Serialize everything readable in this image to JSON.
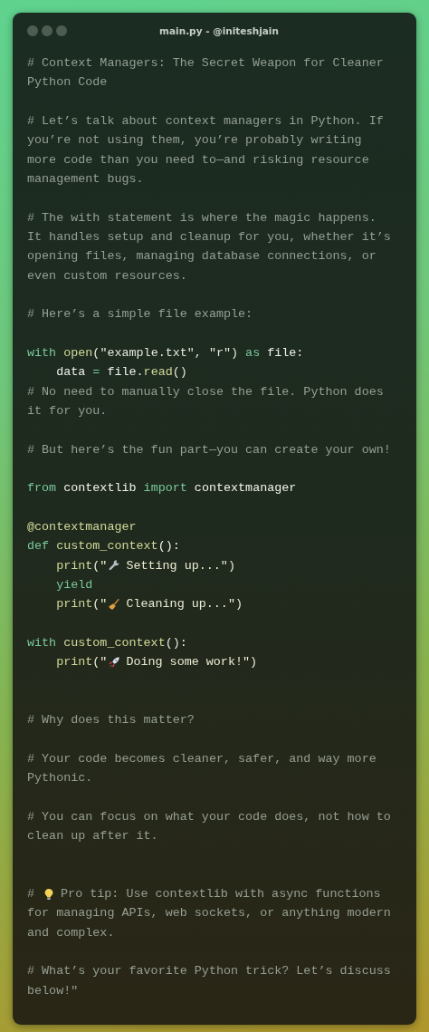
{
  "window": {
    "title": "main.py - @initeshjain"
  },
  "lines": [
    {
      "kind": "code",
      "tokens": [
        {
          "kind": "comment",
          "text": "# Context Managers: The Secret Weapon for Cleaner"
        }
      ]
    },
    {
      "kind": "code",
      "tokens": [
        {
          "kind": "comment",
          "text": "Python Code"
        }
      ]
    },
    {
      "kind": "blank"
    },
    {
      "kind": "code",
      "tokens": [
        {
          "kind": "comment",
          "text": "# Let’s talk about context managers in Python. If"
        }
      ]
    },
    {
      "kind": "code",
      "tokens": [
        {
          "kind": "comment",
          "text": "you’re not using them, you’re probably writing"
        }
      ]
    },
    {
      "kind": "code",
      "tokens": [
        {
          "kind": "comment",
          "text": "more code than you need to—and risking resource"
        }
      ]
    },
    {
      "kind": "code",
      "tokens": [
        {
          "kind": "comment",
          "text": "management bugs."
        }
      ]
    },
    {
      "kind": "blank"
    },
    {
      "kind": "code",
      "tokens": [
        {
          "kind": "comment",
          "text": "# The with statement is where the magic happens."
        }
      ]
    },
    {
      "kind": "code",
      "tokens": [
        {
          "kind": "comment",
          "text": "It handles setup and cleanup for you, whether it’s"
        }
      ]
    },
    {
      "kind": "code",
      "tokens": [
        {
          "kind": "comment",
          "text": "opening files, managing database connections, or"
        }
      ]
    },
    {
      "kind": "code",
      "tokens": [
        {
          "kind": "comment",
          "text": "even custom resources."
        }
      ]
    },
    {
      "kind": "blank"
    },
    {
      "kind": "code",
      "tokens": [
        {
          "kind": "comment",
          "text": "# Here’s a simple file example:"
        }
      ]
    },
    {
      "kind": "blank"
    },
    {
      "kind": "code",
      "tokens": [
        {
          "kind": "keyword",
          "text": "with "
        },
        {
          "kind": "function",
          "text": "open"
        },
        {
          "kind": "plain",
          "text": "(\"example.txt\", \"r\") "
        },
        {
          "kind": "keyword",
          "text": "as "
        },
        {
          "kind": "name",
          "text": "file"
        },
        {
          "kind": "plain",
          "text": ":"
        }
      ]
    },
    {
      "kind": "code",
      "tokens": [
        {
          "kind": "name",
          "text": "    data "
        },
        {
          "kind": "keyword",
          "text": "= "
        },
        {
          "kind": "name",
          "text": "file"
        },
        {
          "kind": "plain",
          "text": "."
        },
        {
          "kind": "function",
          "text": "read"
        },
        {
          "kind": "plain",
          "text": "()"
        }
      ]
    },
    {
      "kind": "code",
      "tokens": [
        {
          "kind": "comment",
          "text": "# No need to manually close the file. Python does"
        }
      ]
    },
    {
      "kind": "code",
      "tokens": [
        {
          "kind": "comment",
          "text": "it for you."
        }
      ]
    },
    {
      "kind": "blank"
    },
    {
      "kind": "code",
      "tokens": [
        {
          "kind": "comment",
          "text": "# But here’s the fun part—you can create your own!"
        }
      ]
    },
    {
      "kind": "blank"
    },
    {
      "kind": "code",
      "tokens": [
        {
          "kind": "keyword",
          "text": "from "
        },
        {
          "kind": "name",
          "text": "contextlib "
        },
        {
          "kind": "keyword",
          "text": "import "
        },
        {
          "kind": "name",
          "text": "contextmanager"
        }
      ]
    },
    {
      "kind": "blank"
    },
    {
      "kind": "code",
      "tokens": [
        {
          "kind": "function",
          "text": "@contextmanager"
        }
      ]
    },
    {
      "kind": "code",
      "tokens": [
        {
          "kind": "keyword",
          "text": "def "
        },
        {
          "kind": "function",
          "text": "custom_context"
        },
        {
          "kind": "name",
          "text": "():"
        }
      ]
    },
    {
      "kind": "code",
      "tokens": [
        {
          "kind": "function",
          "text": "    print"
        },
        {
          "kind": "string",
          "text": "(\""
        },
        {
          "kind": "wrench"
        },
        {
          "kind": "string",
          "text": "Setting up...\")"
        }
      ]
    },
    {
      "kind": "code",
      "tokens": [
        {
          "kind": "keyword",
          "text": "    yield"
        }
      ]
    },
    {
      "kind": "code",
      "tokens": [
        {
          "kind": "function",
          "text": "    print"
        },
        {
          "kind": "string",
          "text": "(\""
        },
        {
          "kind": "broom"
        },
        {
          "kind": "string",
          "text": "Cleaning up...\")"
        }
      ]
    },
    {
      "kind": "blank"
    },
    {
      "kind": "code",
      "tokens": [
        {
          "kind": "keyword",
          "text": "with "
        },
        {
          "kind": "function",
          "text": "custom_context"
        },
        {
          "kind": "plain",
          "text": "():"
        }
      ]
    },
    {
      "kind": "code",
      "tokens": [
        {
          "kind": "function",
          "text": "    print"
        },
        {
          "kind": "string",
          "text": "(\""
        },
        {
          "kind": "rocket"
        },
        {
          "kind": "string",
          "text": "Doing some work!\")"
        }
      ]
    },
    {
      "kind": "blank"
    },
    {
      "kind": "blank"
    },
    {
      "kind": "code",
      "tokens": [
        {
          "kind": "comment",
          "text": "# Why does this matter?"
        }
      ]
    },
    {
      "kind": "blank"
    },
    {
      "kind": "code",
      "tokens": [
        {
          "kind": "comment",
          "text": "# Your code becomes cleaner, safer, and way more"
        }
      ]
    },
    {
      "kind": "code",
      "tokens": [
        {
          "kind": "comment",
          "text": "Pythonic."
        }
      ]
    },
    {
      "kind": "blank"
    },
    {
      "kind": "code",
      "tokens": [
        {
          "kind": "comment",
          "text": "# You can focus on what your code does, not how to"
        }
      ]
    },
    {
      "kind": "code",
      "tokens": [
        {
          "kind": "comment",
          "text": "clean up after it."
        }
      ]
    },
    {
      "kind": "blank"
    },
    {
      "kind": "blank"
    },
    {
      "kind": "code",
      "tokens": [
        {
          "kind": "comment",
          "text": "# "
        },
        {
          "kind": "bulb"
        },
        {
          "kind": "comment",
          "text": "Pro tip: Use contextlib with async functions"
        }
      ]
    },
    {
      "kind": "code",
      "tokens": [
        {
          "kind": "comment",
          "text": "for managing APIs, web sockets, or anything modern"
        }
      ]
    },
    {
      "kind": "code",
      "tokens": [
        {
          "kind": "comment",
          "text": "and complex."
        }
      ]
    },
    {
      "kind": "blank"
    },
    {
      "kind": "code",
      "tokens": [
        {
          "kind": "comment",
          "text": "# What’s your favorite Python trick? Let’s discuss"
        }
      ]
    },
    {
      "kind": "code",
      "tokens": [
        {
          "kind": "comment",
          "text": "below!\""
        }
      ]
    }
  ]
}
